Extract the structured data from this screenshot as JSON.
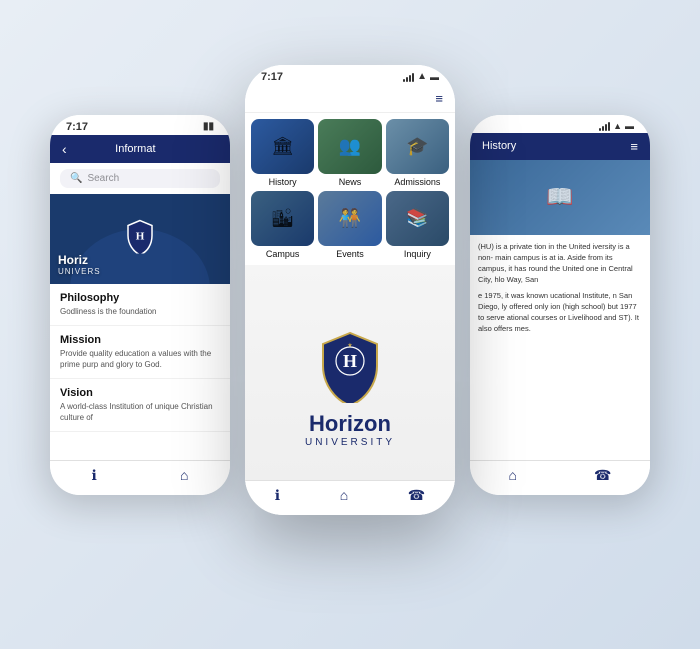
{
  "left_phone": {
    "status_bar": {
      "time": "7:17"
    },
    "nav": {
      "title": "Informat",
      "back_label": "‹"
    },
    "search": {
      "placeholder": "Search"
    },
    "hero": {
      "title": "Horiz",
      "subtitle": "UNIVERS"
    },
    "sections": [
      {
        "title": "Philosophy",
        "text": "Godliness is the foundation"
      },
      {
        "title": "Mission",
        "text": "Provide quality education a values with the prime purp and glory to God."
      },
      {
        "title": "Vision",
        "text": "A world-class Institution of unique Christian culture of"
      }
    ],
    "tabs": [
      "ℹ",
      "⌂"
    ]
  },
  "center_phone": {
    "status_bar": {
      "time": "7:17"
    },
    "grid_items": [
      {
        "label": "History",
        "icon": "🏛"
      },
      {
        "label": "News",
        "icon": "👥"
      },
      {
        "label": "Admissions",
        "icon": "🎓"
      },
      {
        "label": "Campus",
        "icon": "🏙"
      },
      {
        "label": "Events",
        "icon": "🧑‍🤝‍🧑"
      },
      {
        "label": "Inquiry",
        "icon": "📚"
      }
    ],
    "splash": {
      "university_name": "Horizon",
      "university_sub": "UNIVERSITY"
    },
    "tabs": [
      "ℹ",
      "⌂",
      "☎"
    ]
  },
  "right_phone": {
    "status_bar": {
      "time": ""
    },
    "nav": {
      "title": "History"
    },
    "body_text": "(HU) is a private tion in the United iversity is a non- main campus is at ia. Aside from its campus, it has round the United one in Central City, hlo Way, San",
    "body_text2": "e 1975, it was known ucational Institute, n San Diego, ly offered only ion (high school) but 1977 to serve ational courses or Livelihood and ST). It also offers mes.",
    "is_a_private": "is a private",
    "tabs": [
      "⌂",
      "☎"
    ]
  }
}
